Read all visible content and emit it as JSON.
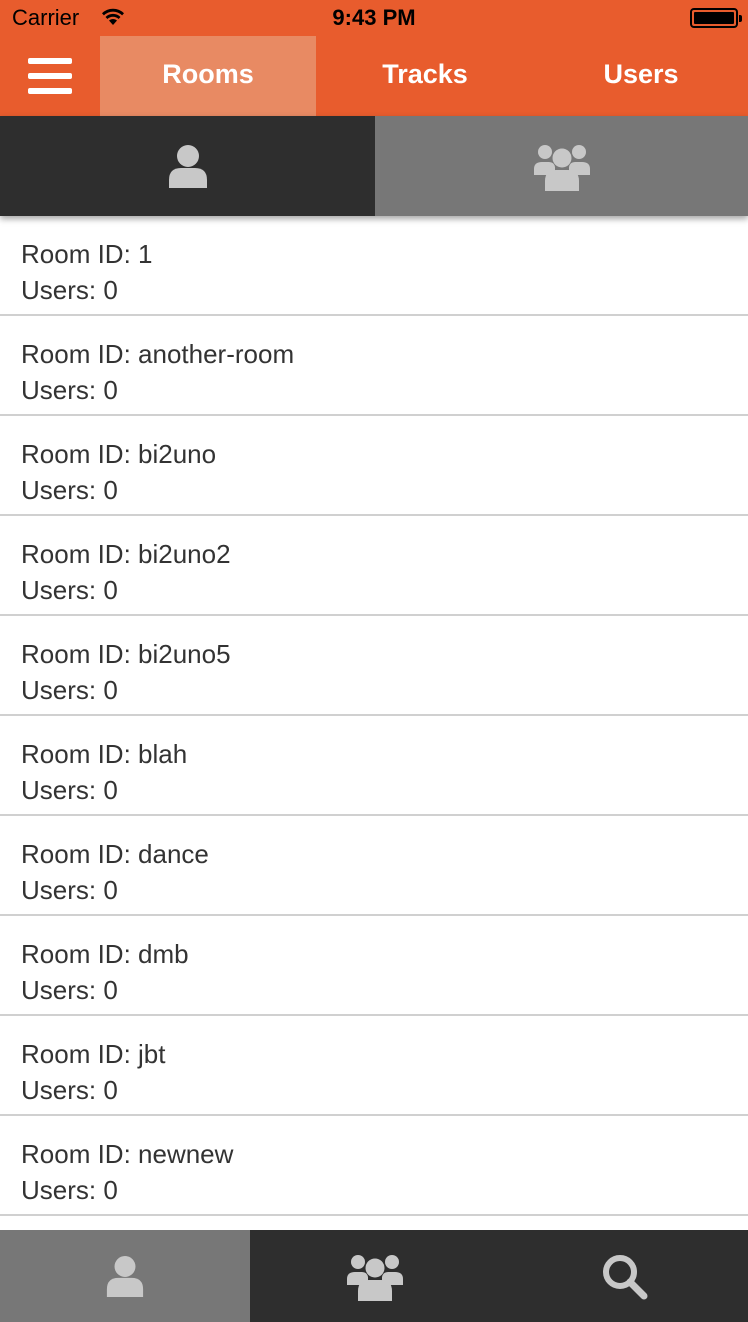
{
  "status_bar": {
    "carrier": "Carrier",
    "time": "9:43 PM"
  },
  "nav": {
    "menu_icon": "hamburger-icon",
    "tabs": [
      {
        "label": "Rooms",
        "active": true
      },
      {
        "label": "Tracks",
        "active": false
      },
      {
        "label": "Users",
        "active": false
      }
    ]
  },
  "segments": [
    {
      "icon": "user-icon",
      "active": true
    },
    {
      "icon": "users-group-icon",
      "active": false
    }
  ],
  "rooms": [
    {
      "id_label": "Room ID: 1",
      "users_label": "Users: 0"
    },
    {
      "id_label": "Room ID: another-room",
      "users_label": "Users: 0"
    },
    {
      "id_label": "Room ID: bi2uno",
      "users_label": "Users: 0"
    },
    {
      "id_label": "Room ID: bi2uno2",
      "users_label": "Users: 0"
    },
    {
      "id_label": "Room ID: bi2uno5",
      "users_label": "Users: 0"
    },
    {
      "id_label": "Room ID: blah",
      "users_label": "Users: 0"
    },
    {
      "id_label": "Room ID: dance",
      "users_label": "Users: 0"
    },
    {
      "id_label": "Room ID: dmb",
      "users_label": "Users: 0"
    },
    {
      "id_label": "Room ID: jbt",
      "users_label": "Users: 0"
    },
    {
      "id_label": "Room ID: newnew",
      "users_label": "Users: 0"
    }
  ],
  "tab_bar": [
    {
      "icon": "user-icon",
      "active": true
    },
    {
      "icon": "users-group-icon",
      "active": false
    },
    {
      "icon": "search-icon",
      "active": false
    }
  ],
  "colors": {
    "brand_orange": "#e85c2d",
    "active_tab_highlight": "#e88a63",
    "dark_bar": "#2e2e2e",
    "grey_bar": "#777777",
    "icon_grey": "#c8c8c8"
  }
}
